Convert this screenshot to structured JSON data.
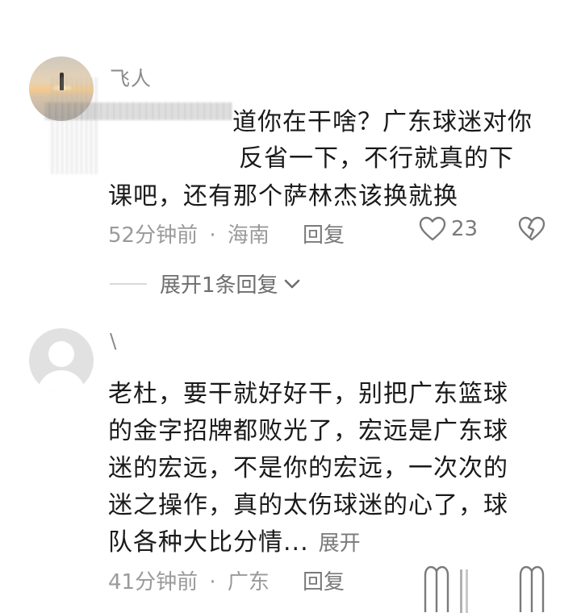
{
  "comments": [
    {
      "username": "飞人",
      "lines": [
        "道你在干啥？广东球迷对你",
        "反省一下，不行就真的下",
        "课吧，还有那个萨林杰该换就换"
      ],
      "time": "52分钟前",
      "location": "海南",
      "separator": "·",
      "reply_label": "回复",
      "like_count": "23",
      "expand_replies_label": "展开1条回复"
    },
    {
      "username": "\\",
      "lines": [
        "老杜，要干就好好干，别把广东篮球",
        "的金字招牌都败光了，宏远是广东球",
        "迷的宏远，不是你的宏远，一次次的",
        "迷之操作，真的太伤球迷的心了，球",
        "队各种大比分情..."
      ],
      "expand_inline_label": "展开",
      "time": "41分钟前",
      "location": "广东",
      "separator": "·",
      "reply_label": "回复"
    }
  ],
  "icons": {
    "like": "heart-outline-icon",
    "dislike": "broken-heart-icon",
    "expand": "chevron-down-icon"
  },
  "colors": {
    "text": "#1a1a1a",
    "meta": "#9a9a9a",
    "username": "#8a8a8a"
  }
}
